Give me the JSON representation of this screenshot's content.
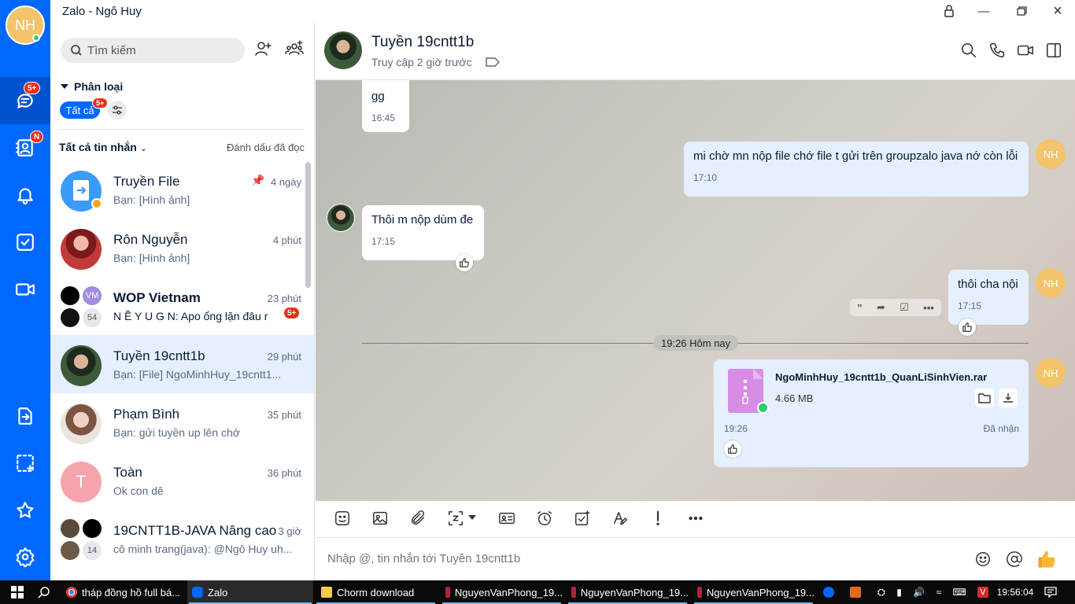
{
  "window": {
    "title": "Zalo - Ngô Huy"
  },
  "me": {
    "initials": "NH"
  },
  "rail": {
    "messages_badge": "5+",
    "contacts_badge": "N"
  },
  "search": {
    "placeholder": "Tìm kiếm"
  },
  "category": {
    "label": "Phân loại",
    "chip_all": "Tất cả",
    "chip_all_badge": "5+"
  },
  "list_header": {
    "title": "Tất cả tin nhắn",
    "mark_read": "Đánh dấu đã đọc"
  },
  "conversations": [
    {
      "name": "Truyền File",
      "preview": "Bạn: [Hình ảnh]",
      "time": "4 ngày"
    },
    {
      "name": "Rôn Nguyễn",
      "preview": "Bạn: [Hình ảnh]",
      "time": "4 phút"
    },
    {
      "name": "WOP Vietnam",
      "preview": "N Ề Y U G N: Apo ổng lặn đâu r",
      "time": "23 phút",
      "badge": "5+",
      "count": "54",
      "vm": "VM"
    },
    {
      "name": "Tuyền 19cntt1b",
      "preview": "Bạn: [File] NgoMinhHuy_19cntt1...",
      "time": "29 phút"
    },
    {
      "name": "Phạm Bình",
      "preview": "Bạn: gửi tuyền up lên chớ",
      "time": "35 phút"
    },
    {
      "name": "Toàn",
      "preview": "Ok con dê",
      "time": "36 phút",
      "initial": "T"
    },
    {
      "name": "19CNTT1B-JAVA Nâng cao",
      "preview": "cô minh trang(java): @Ngô Huy uh...",
      "time": "3 giờ",
      "count": "14"
    }
  ],
  "chat": {
    "name": "Tuyền 19cntt1b",
    "status": "Truy cập 2 giờ trước",
    "messages": [
      {
        "dir": "in",
        "text": "gg",
        "time": "16:45"
      },
      {
        "dir": "out",
        "text": "mi chờ mn nộp file chớ file t gửi trên groupzalo java nớ còn lỗi",
        "time": "17:10"
      },
      {
        "dir": "in",
        "text": "Thôi m nộp dùm đe",
        "time": "17:15"
      },
      {
        "dir": "out",
        "text": "thôi cha nội",
        "time": "17:15"
      }
    ],
    "day_divider": "19:26 Hôm nay",
    "file": {
      "name": "NgoMinhHuy_19cntt1b_QuanLiSinhVien.rar",
      "size": "4.66 MB",
      "time": "19:26",
      "status": "Đã nhận"
    }
  },
  "compose": {
    "placeholder": "Nhập @, tin nhắn tới Tuyền 19cntt1b"
  },
  "taskbar": {
    "items": [
      "tháp đồng hồ full bá...",
      "Zalo",
      "Chorm download",
      "NguyenVanPhong_19...",
      "NguyenVanPhong_19...",
      "NguyenVanPhong_19..."
    ],
    "clock": "19:56:04"
  }
}
